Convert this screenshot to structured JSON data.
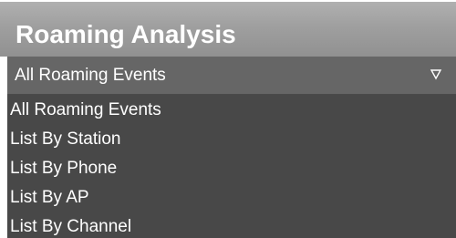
{
  "panel": {
    "title": "Roaming Analysis"
  },
  "selector": {
    "value": "All Roaming Events",
    "arrow_icon": "triangle-down-outline-icon"
  },
  "options": [
    "All Roaming Events",
    "List By Station",
    "List By Phone",
    "List By AP",
    "List By Channel"
  ],
  "colors": {
    "header_background": "#a0a0a0",
    "select_background": "#666666",
    "options_background": "#484848",
    "text": "#ffffff"
  }
}
